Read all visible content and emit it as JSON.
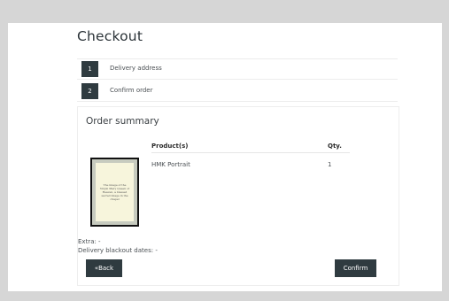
{
  "checkout": {
    "title": "Checkout"
  },
  "steps": [
    {
      "number": "1",
      "label": "Delivery address"
    },
    {
      "number": "2",
      "label": "Confirm order"
    }
  ],
  "summary": {
    "title": "Order summary",
    "columns": {
      "product": "Product(s)",
      "qty": "Qty."
    },
    "rows": [
      {
        "product": "HMK Portrait",
        "qty": "1",
        "thumbnail_text": "The image of the Virgin Mary Queen of Heaven, a blessed sacred image in the chapel"
      }
    ],
    "extra": "Extra: -",
    "blackout": "Delivery blackout dates: -"
  },
  "actions": {
    "back": "«Back",
    "confirm": "Confirm"
  },
  "colors": {
    "accent": "#2f3b40",
    "background": "#d6d6d6"
  }
}
